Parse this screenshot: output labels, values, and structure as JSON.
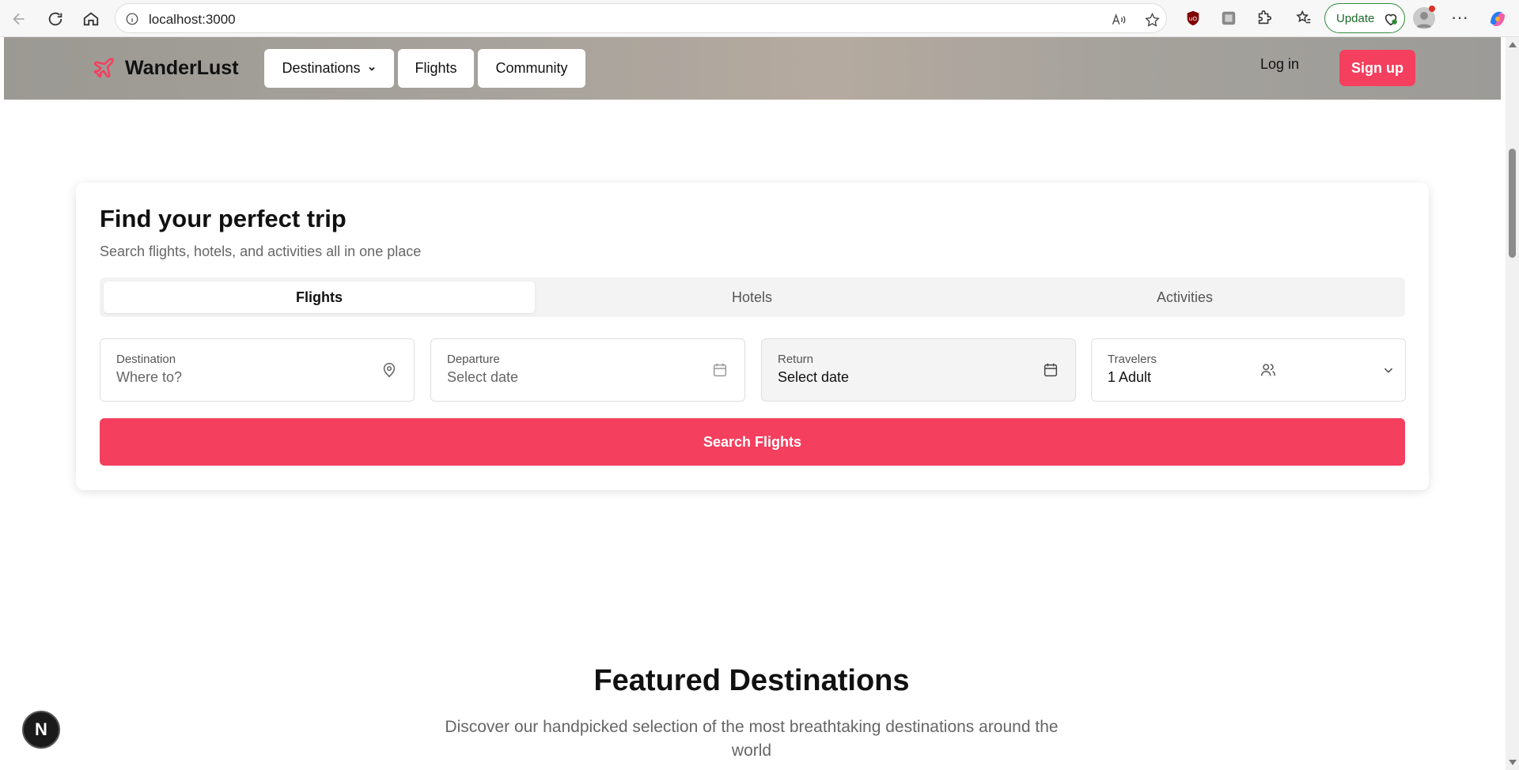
{
  "browser": {
    "url": "localhost:3000",
    "update_label": "Update",
    "menu_label": "···"
  },
  "site": {
    "brand": "WanderLust",
    "accent_color": "#f43f5e",
    "nav": {
      "destinations": "Destinations",
      "flights": "Flights",
      "community": "Community"
    },
    "login": "Log in",
    "signup": "Sign up"
  },
  "search": {
    "title": "Find your perfect trip",
    "subtitle": "Search flights, hotels, and activities all in one place",
    "tabs": [
      {
        "label": "Flights",
        "active": true
      },
      {
        "label": "Hotels",
        "active": false
      },
      {
        "label": "Activities",
        "active": false
      }
    ],
    "fields": {
      "destination": {
        "label": "Destination",
        "placeholder": "Where to?",
        "icon": "map-pin-icon"
      },
      "departure": {
        "label": "Departure",
        "placeholder": "Select date",
        "icon": "calendar-icon"
      },
      "return": {
        "label": "Return",
        "value": "Select date",
        "icon": "calendar-icon"
      },
      "travelers": {
        "label": "Travelers",
        "value": "1 Adult",
        "icon": "users-icon"
      }
    },
    "button": "Search Flights"
  },
  "featured": {
    "title": "Featured Destinations",
    "subtitle": "Discover our handpicked selection of the most breathtaking destinations around the world"
  },
  "dev_badge": "N"
}
